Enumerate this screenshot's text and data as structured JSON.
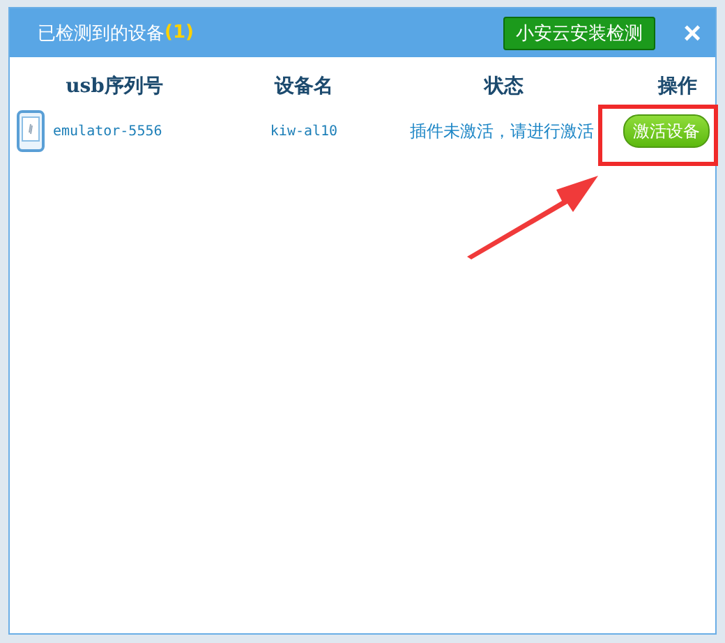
{
  "window": {
    "title": "已检测到的设备",
    "count": "(1)",
    "header_button": "小安云安装检测",
    "close": "×"
  },
  "table": {
    "columns": [
      "usb序列号",
      "设备名",
      "状态",
      "操作"
    ],
    "rows": [
      {
        "serial": "emulator-5556",
        "name": "kiw-al10",
        "status": "插件未激活，请进行激活",
        "action": "激活设备"
      }
    ]
  }
}
